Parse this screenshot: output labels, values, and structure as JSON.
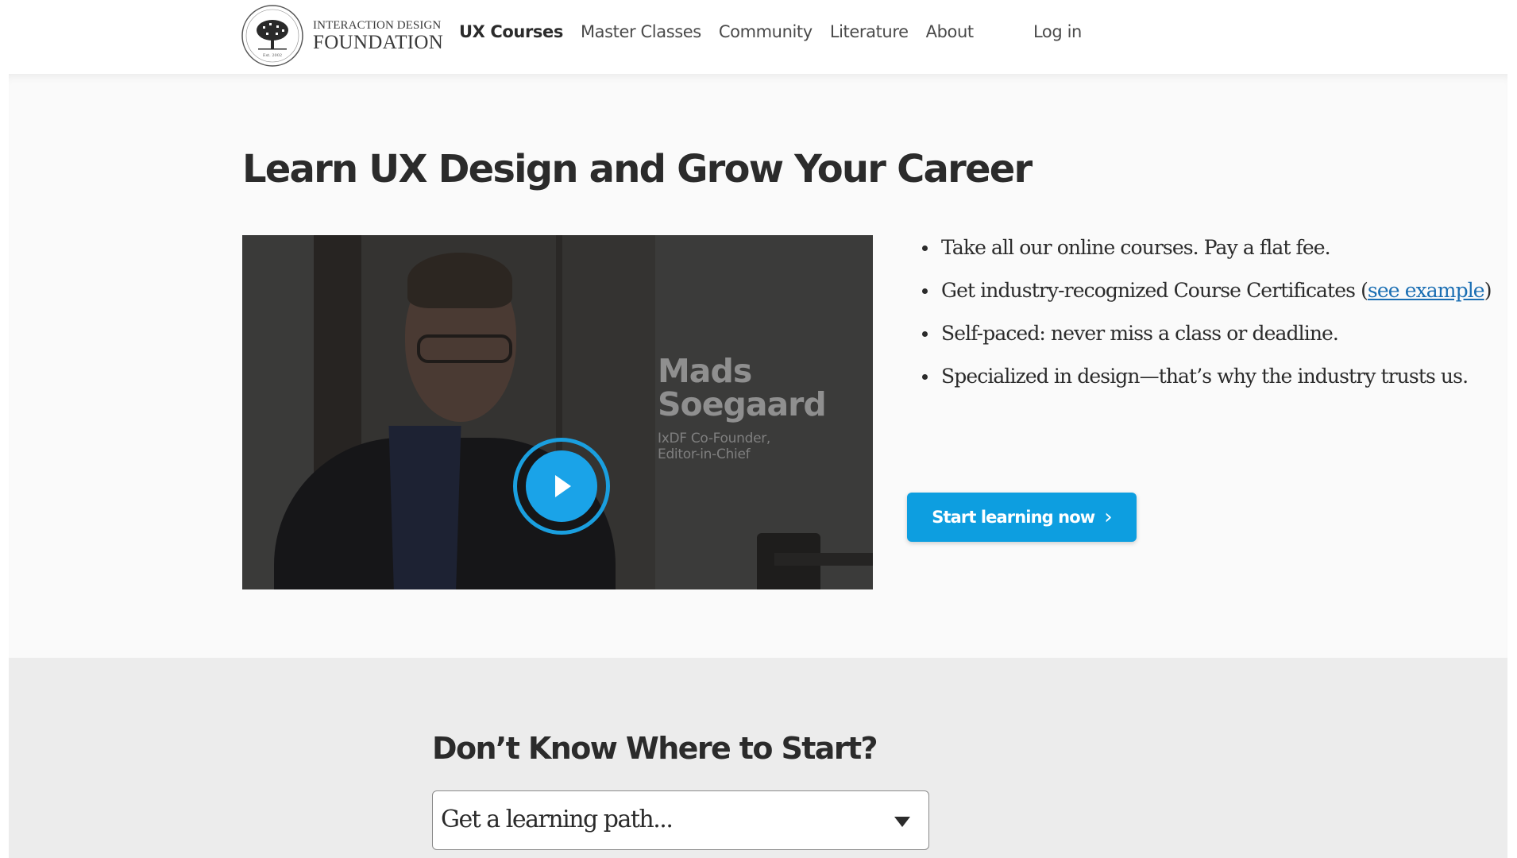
{
  "header": {
    "logo": {
      "line1": "INTERACTION DESIGN",
      "line2": "FOUNDATION",
      "emblem_text": "Est. 2002"
    },
    "nav": [
      {
        "label": "UX Courses",
        "active": true
      },
      {
        "label": "Master Classes",
        "active": false
      },
      {
        "label": "Community",
        "active": false
      },
      {
        "label": "Literature",
        "active": false
      },
      {
        "label": "About",
        "active": false
      }
    ],
    "login_label": "Log in"
  },
  "hero": {
    "title": "Learn UX Design and Grow Your Career",
    "video": {
      "speaker_name_line1": "Mads",
      "speaker_name_line2": "Soegaard",
      "speaker_role_line1": "IxDF Co-Founder,",
      "speaker_role_line2": "Editor-in-Chief",
      "play_icon": "play-icon"
    },
    "benefits": [
      {
        "text": "Take all our online courses. Pay a flat fee."
      },
      {
        "text_before": "Get industry-recognized Course Certificates (",
        "link": "see example",
        "text_after": ")"
      },
      {
        "text": "Self-paced: never miss a class or deadline."
      },
      {
        "text": "Specialized in design—that’s why the industry trusts us."
      }
    ],
    "cta_label": "Start learning now",
    "cta_icon": "chevron-right-icon"
  },
  "lower": {
    "title": "Don’t Know Where to Start?",
    "select_value": "Get a learning path...",
    "select_icon": "caret-down-icon"
  },
  "colors": {
    "accent": "#0d9ee0",
    "link": "#1a6eb3",
    "text": "#2b2b2b",
    "hero_bg": "#fafafa",
    "lower_bg": "#ececec"
  }
}
